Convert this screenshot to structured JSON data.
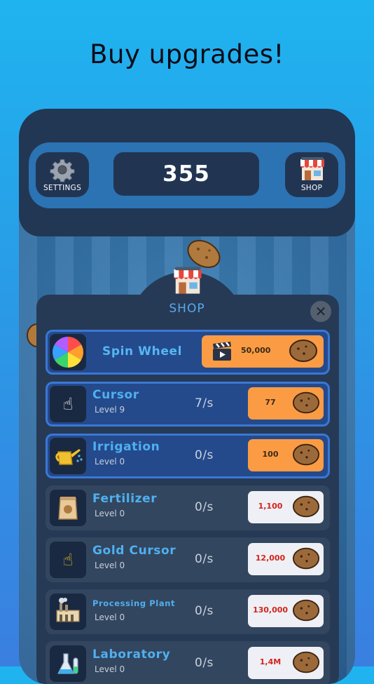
{
  "headline": "Buy upgrades!",
  "topbar": {
    "settings_label": "SETTINGS",
    "settings_icon": "gear-icon",
    "score": "355",
    "shop_label": "SHOP",
    "shop_icon": "store-icon"
  },
  "shop": {
    "title": "SHOP",
    "close_icon": "close-icon",
    "spin_wheel": {
      "name": "Spin Wheel",
      "price": "50,000",
      "icon": "color-wheel-icon",
      "button_icon": "clapperboard-icon"
    },
    "items": [
      {
        "name": "Cursor",
        "level": "Level 9",
        "rate": "7/s",
        "price": "77",
        "icon": "hand-cursor-icon",
        "state": "affordable"
      },
      {
        "name": "Irrigation",
        "level": "Level 0",
        "rate": "0/s",
        "price": "100",
        "icon": "watering-can-icon",
        "state": "affordable"
      },
      {
        "name": "Fertilizer",
        "level": "Level 0",
        "rate": "0/s",
        "price": "1,100",
        "icon": "fertilizer-bag-icon",
        "state": "locked"
      },
      {
        "name": "Gold Cursor",
        "level": "Level 0",
        "rate": "0/s",
        "price": "12,000",
        "icon": "gold-hand-icon",
        "state": "locked"
      },
      {
        "name": "Processing Plant",
        "level": "Level 0",
        "rate": "0/s",
        "price": "130,000",
        "icon": "factory-icon",
        "state": "locked"
      },
      {
        "name": "Laboratory",
        "level": "Level 0",
        "rate": "0/s",
        "price": "1,4M",
        "icon": "flask-icon",
        "state": "locked"
      }
    ]
  },
  "colors": {
    "background_top": "#1fb4f0",
    "panel": "#263a56",
    "accent_blue": "#4fb0f0",
    "buy_orange": "#fb9c44",
    "price_red": "#d2241c"
  }
}
